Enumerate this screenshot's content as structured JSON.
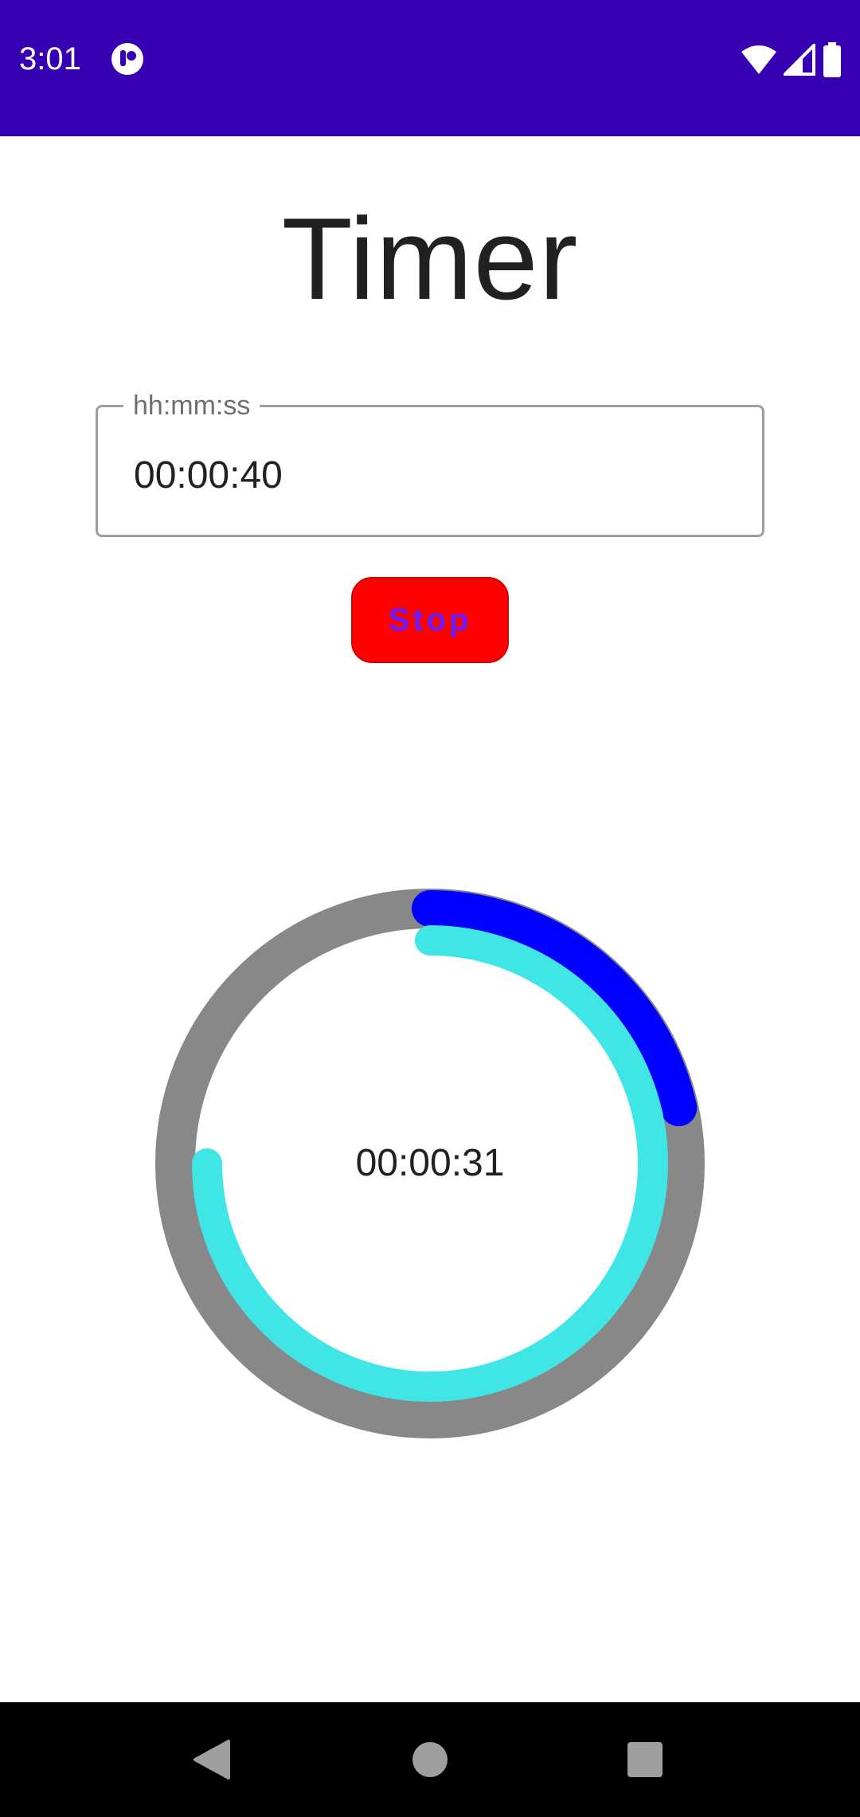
{
  "status_bar": {
    "time": "3:01",
    "app_icon": "notification-app-icon",
    "wifi_icon": "wifi-icon",
    "signal_icon": "cell-signal-icon",
    "battery_icon": "battery-icon",
    "background_color": "#3700b3"
  },
  "title": "Timer",
  "time_field": {
    "label": "hh:mm:ss",
    "value": "00:00:40"
  },
  "stop_button": {
    "label": "Stop",
    "background_color": "#ff0000",
    "text_color": "#6a1bff"
  },
  "progress": {
    "remaining_text": "00:00:31",
    "track_color": "#888888",
    "outer_arc_color": "#0000ff",
    "inner_arc_color": "#40e6e6",
    "outer_arc_fraction": 0.215,
    "inner_arc_fraction": 0.75
  },
  "nav_bar": {
    "back_icon": "back-triangle-icon",
    "home_icon": "home-circle-icon",
    "recents_icon": "recents-square-icon"
  }
}
